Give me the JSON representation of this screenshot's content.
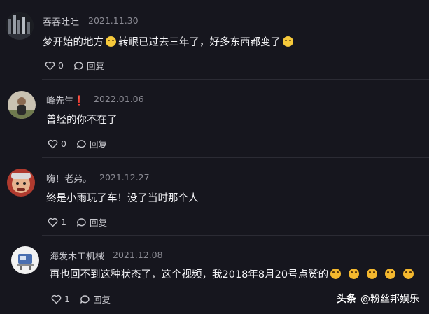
{
  "comments": [
    {
      "username": "吞吞吐吐",
      "date": "2021.11.30",
      "text_a": "梦开始的地方",
      "text_b": "转眼已过去三年了，好多东西都变了",
      "likes": "0",
      "reply_label": "回复"
    },
    {
      "username": "峰先生❗",
      "date": "2022.01.06",
      "text": "曾经的你不在了",
      "likes": "0",
      "reply_label": "回复"
    },
    {
      "username": "嗨！老弟。",
      "date": "2021.12.27",
      "text": "终是小雨玩了车！没了当时那个人",
      "likes": "1",
      "reply_label": "回复"
    },
    {
      "username": "海发木工机械",
      "date": "2021.12.08",
      "text": "再也回不到这种状态了，这个视频，我2018年8月20号点赞的",
      "likes": "1",
      "reply_label": "回复"
    }
  ],
  "watermark": {
    "brand": "头条",
    "handle": "@粉丝邦娱乐"
  },
  "colors": {
    "background": "#16161e",
    "emoji": "#f6c93b"
  }
}
